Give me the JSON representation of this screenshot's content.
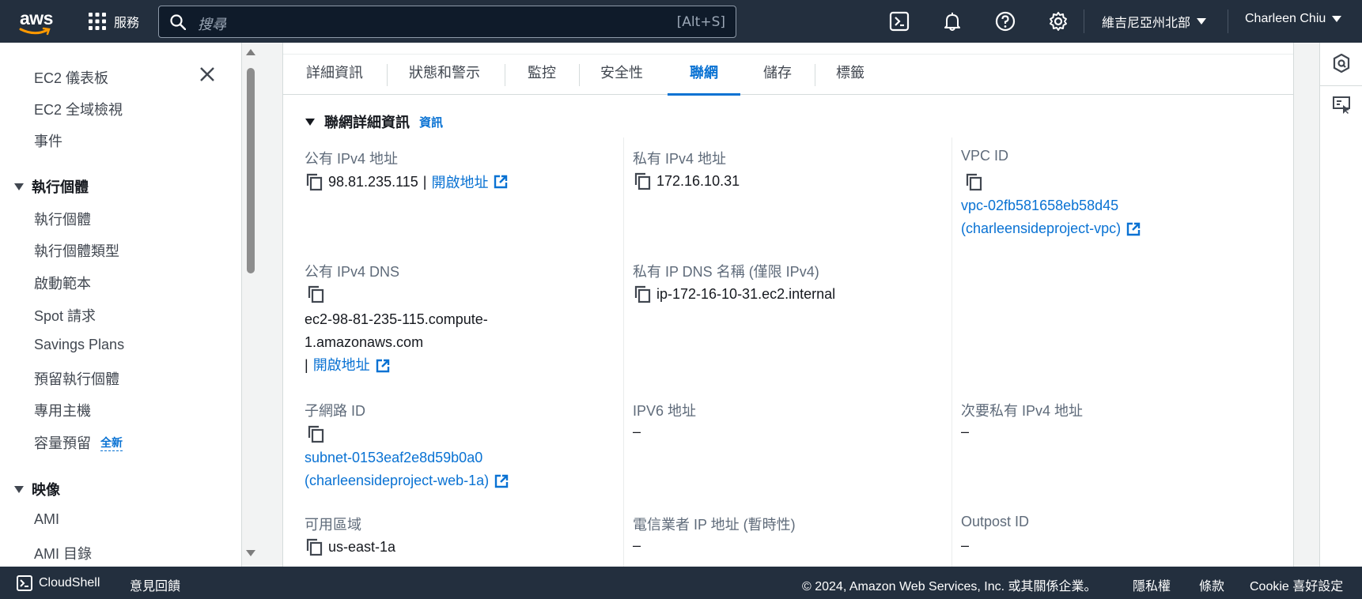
{
  "topnav": {
    "logo": "aws",
    "services_label": "服務",
    "search_placeholder": "搜尋",
    "search_shortcut": "[Alt+S]",
    "region": "維吉尼亞州北部",
    "user": "Charleen Chiu",
    "icons": [
      "cloudshell-icon",
      "bell-icon",
      "help-icon",
      "settings-icon"
    ]
  },
  "sidebar": {
    "items_top": [
      "EC2 儀表板",
      "EC2 全域檢視",
      "事件"
    ],
    "sections": [
      {
        "title": "執行個體",
        "items": [
          "執行個體",
          "執行個體類型",
          "啟動範本",
          "Spot 請求",
          "Savings Plans",
          "預留執行個體",
          "專用主機",
          "容量預留"
        ]
      },
      {
        "title": "映像",
        "items": [
          "AMI",
          "AMI 目錄"
        ]
      }
    ],
    "new_badge": "全新"
  },
  "tabs": [
    "詳細資訊",
    "狀態和警示",
    "監控",
    "安全性",
    "聯網",
    "儲存",
    "標籤"
  ],
  "active_tab": "聯網",
  "section": {
    "title": "聯網詳細資訊",
    "info": "資訊"
  },
  "fields": {
    "public_ipv4": {
      "label": "公有 IPv4 地址",
      "value": "98.81.235.115",
      "sep": "|",
      "link": "開啟地址"
    },
    "private_ipv4": {
      "label": "私有 IPv4 地址",
      "value": "172.16.10.31"
    },
    "vpc_id": {
      "label": "VPC ID",
      "value_line1": "vpc-02fb581658eb58d45",
      "value_line2": "(charleensideproject-vpc)"
    },
    "public_dns": {
      "label": "公有 IPv4 DNS",
      "value_line1": "ec2-98-81-235-115.compute-",
      "value_line2": "1.amazonaws.com",
      "sep": "|",
      "link": "開啟地址"
    },
    "private_dns": {
      "label": "私有 IP DNS 名稱 (僅限 IPv4)",
      "value": "ip-172-16-10-31.ec2.internal"
    },
    "subnet_id": {
      "label": "子網路 ID",
      "value_line1": "subnet-0153eaf2e8d59b0a0",
      "value_line2": "(charleensideproject-web-1a)"
    },
    "ipv6": {
      "label": "IPV6 地址",
      "value": "–"
    },
    "secondary_private_ipv4": {
      "label": "次要私有 IPv4 地址",
      "value": "–"
    },
    "az": {
      "label": "可用區域",
      "value": "us-east-1a"
    },
    "carrier_ip": {
      "label": "電信業者 IP 地址 (暫時性)",
      "value": "–"
    },
    "outpost_id": {
      "label": "Outpost ID",
      "value": "–"
    }
  },
  "footer": {
    "cloudshell": "CloudShell",
    "feedback": "意見回饋",
    "copyright": "© 2024, Amazon Web Services, Inc. 或其關係企業。",
    "privacy": "隱私權",
    "terms": "條款",
    "cookie": "Cookie 喜好設定"
  },
  "colors": {
    "nav_bg": "#232f3e",
    "link": "#0972d3",
    "text": "#16191f",
    "label": "#5f6b7a"
  }
}
